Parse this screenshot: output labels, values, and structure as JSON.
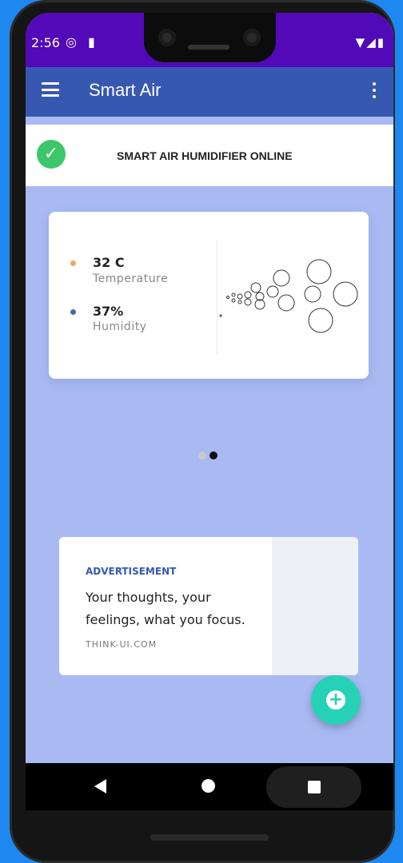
{
  "status_bar": {
    "time": "2:56",
    "left_icons": [
      "circle-notification-icon",
      "sd-card-icon"
    ],
    "right_icons": [
      "wifi-icon",
      "signal-icon",
      "battery-icon"
    ]
  },
  "app_bar": {
    "title": "Smart Air"
  },
  "status_banner": {
    "text": "SMART AIR HUMIDIFIER ONLINE"
  },
  "sensor_card": {
    "temperature": {
      "value": "32 C",
      "label": "Temperature"
    },
    "humidity": {
      "value": "37%",
      "label": "Humidity"
    }
  },
  "pager": {
    "pages": 2,
    "active_index": 1
  },
  "ad": {
    "tag": "ADVERTISEMENT",
    "text": "Your thoughts, your feelings, what you focus.",
    "url": "THINK-UI.COM"
  },
  "colors": {
    "status_bar": "#5209b8",
    "app_bar": "#3758b0",
    "background": "#a9baf3",
    "check": "#3cc76a",
    "fab": "#27d1b6",
    "temperature_dot": "#f0a46a",
    "humidity_dot": "#4a63b8"
  }
}
